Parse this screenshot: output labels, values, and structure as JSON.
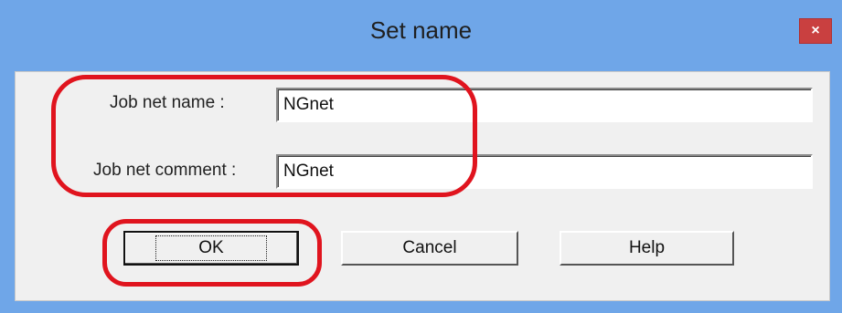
{
  "dialog": {
    "title": "Set name",
    "close_label": "×"
  },
  "form": {
    "job_net_name_label": "Job net name :",
    "job_net_name_value": "NGnet",
    "job_net_comment_label": "Job net comment :",
    "job_net_comment_value": "NGnet"
  },
  "buttons": {
    "ok": "OK",
    "cancel": "Cancel",
    "help": "Help"
  },
  "colors": {
    "titlebar": "#6fa6e8",
    "close_button": "#c94040",
    "highlight": "#e0141e"
  }
}
